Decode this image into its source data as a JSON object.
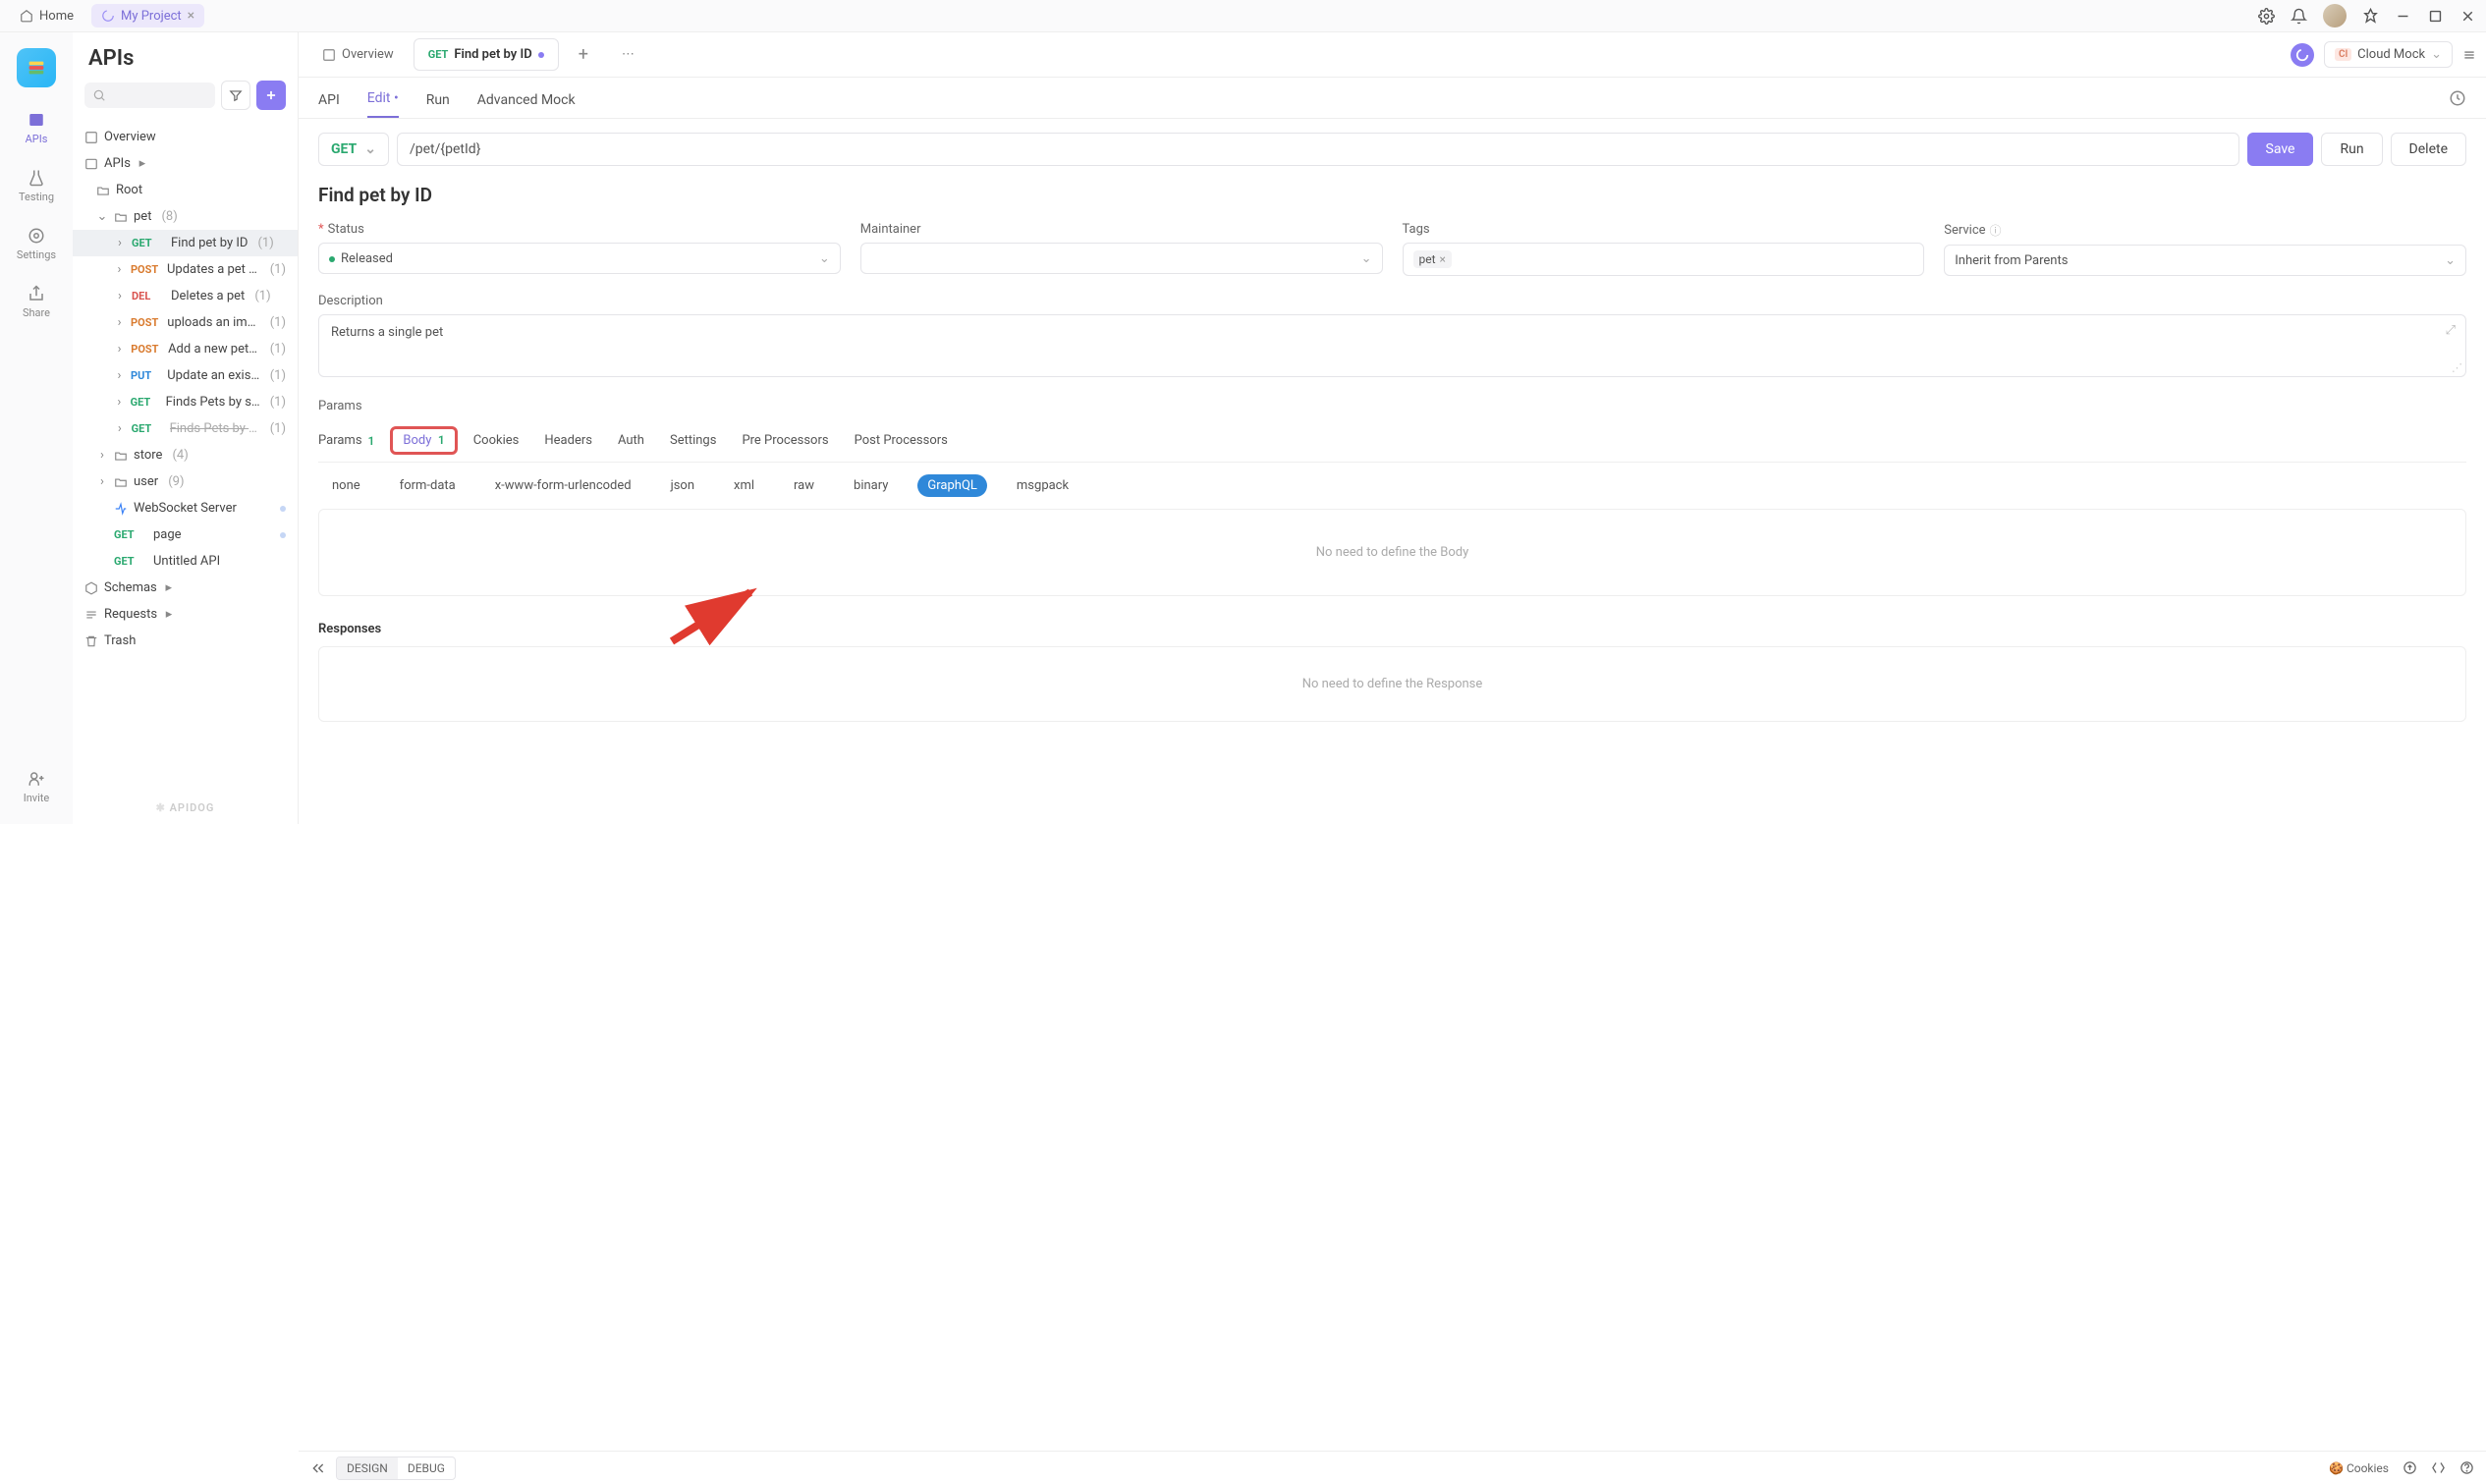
{
  "titlebar": {
    "home": "Home",
    "project_tab": "My Project"
  },
  "rail": {
    "apis": "APIs",
    "testing": "Testing",
    "settings": "Settings",
    "share": "Share",
    "invite": "Invite"
  },
  "sidebar": {
    "title": "APIs",
    "overview": "Overview",
    "apis_group": "APIs",
    "root": "Root",
    "pet_folder": "pet",
    "pet_count": "(8)",
    "store_folder": "store",
    "store_count": "(4)",
    "user_folder": "user",
    "user_count": "(9)",
    "ws": "WebSocket Server",
    "page": "page",
    "untitled": "Untitled API",
    "schemas": "Schemas",
    "requests": "Requests",
    "trash": "Trash",
    "footer": "APIDOG",
    "pet": {
      "find": "Find pet by ID",
      "find_c": "(1)",
      "upd": "Updates a pet in...",
      "upd_c": "(1)",
      "del": "Deletes a pet",
      "del_c": "(1)",
      "upl": "uploads an image",
      "upl_c": "(1)",
      "add": "Add a new pet t...",
      "add_c": "(1)",
      "put": "Update an existi...",
      "put_c": "(1)",
      "fbs": "Finds Pets by sta...",
      "fbs_c": "(1)",
      "fbt": "Finds Pets by t...",
      "fbt_c": "(1)"
    }
  },
  "tabs": {
    "overview": "Overview",
    "method": "GET",
    "title": "Find pet by ID"
  },
  "env": {
    "label": "Cloud Mock",
    "badge": "Cl"
  },
  "subtabs": {
    "api": "API",
    "edit": "Edit",
    "run": "Run",
    "adv": "Advanced Mock"
  },
  "url": {
    "method": "GET",
    "path": "/pet/{petId}",
    "save": "Save",
    "run": "Run",
    "delete": "Delete"
  },
  "apiTitle": "Find pet by ID",
  "meta": {
    "status_l": "Status",
    "status_v": "Released",
    "maint_l": "Maintainer",
    "tags_l": "Tags",
    "tags_v": "pet",
    "service_l": "Service",
    "service_v": "Inherit from Parents"
  },
  "desc": {
    "label": "Description",
    "text": "Returns a single pet"
  },
  "paramsHeading": "Params",
  "ptabs": {
    "params": "Params",
    "params_b": "1",
    "body": "Body",
    "body_b": "1",
    "cookies": "Cookies",
    "headers": "Headers",
    "auth": "Auth",
    "settings": "Settings",
    "pre": "Pre Processors",
    "post": "Post Processors"
  },
  "bodyTypes": {
    "none": "none",
    "form": "form-data",
    "xwww": "x-www-form-urlencoded",
    "json": "json",
    "xml": "xml",
    "raw": "raw",
    "binary": "binary",
    "graphql": "GraphQL",
    "msgpack": "msgpack"
  },
  "emptyBody": "No need to define the Body",
  "responses": {
    "label": "Responses",
    "empty": "No need to define the Response"
  },
  "bottom": {
    "design": "DESIGN",
    "debug": "DEBUG",
    "cookies": "Cookies"
  }
}
